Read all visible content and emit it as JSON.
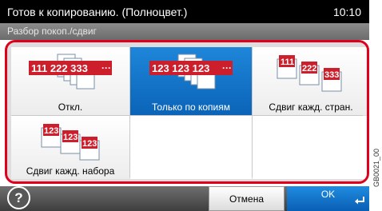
{
  "header": {
    "status": "Готов к копированию. (Полноцвет.)",
    "time": "10:10",
    "subtitle": "Разбор покоп./сдвиг"
  },
  "options": [
    {
      "label": "Откл.",
      "icon": "collate-off-icon",
      "selected": false
    },
    {
      "label": "Только по копиям",
      "icon": "collate-only-icon",
      "selected": true
    },
    {
      "label": "Сдвиг кажд. стран.",
      "icon": "offset-each-page-icon",
      "selected": false
    },
    {
      "label": "Сдвиг кажд. набора",
      "icon": "offset-each-set-icon",
      "selected": false
    }
  ],
  "footer": {
    "help": "?",
    "cancel": "Отмена",
    "ok": "OK"
  },
  "side_code": "GB0021_00",
  "colors": {
    "frame_red": "#e0001b",
    "selected_blue": "#0b64b8",
    "icon_red": "#cc1f2b"
  }
}
